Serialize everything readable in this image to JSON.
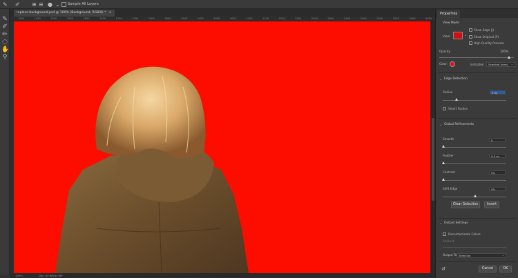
{
  "options_bar": {
    "sample_label": "Sample All Layers"
  },
  "document": {
    "tab_title": "replace background.psd @ 100% (Background, RGB/8) *",
    "close_glyph": "×"
  },
  "ruler_ticks": [
    "1400",
    "1450",
    "1500",
    "1550",
    "1600",
    "1650",
    "1700",
    "1750",
    "1800",
    "1850",
    "1900",
    "1950",
    "2000",
    "2050",
    "2100",
    "2150",
    "2200",
    "2250",
    "2300",
    "2350",
    "2400",
    "2450",
    "2500",
    "2550",
    "2600",
    "2650"
  ],
  "status": {
    "zoom": "100%",
    "doc_info": "Doc: 44.9M/44.9M"
  },
  "colors": {
    "overlay": "#fd0d00"
  },
  "properties": {
    "tab_label": "Properties",
    "view_mode": {
      "title": "View Mode",
      "view_label": "View:",
      "show_edge": "Show Edge (J)",
      "show_original": "Show Original (P)",
      "high_quality": "High Quality Preview"
    },
    "opacity": {
      "label": "Opacity",
      "value": "100%",
      "level": 1.0
    },
    "color": {
      "label": "Color:",
      "indicates_label": "Indicates:",
      "indicates_value": "Selected Areas"
    },
    "edge_detection": {
      "title": "Edge Detection",
      "radius_label": "Radius",
      "radius_value": "0 px",
      "smart_radius": "Smart Radius"
    },
    "global_refinements": {
      "title": "Global Refinements",
      "smooth_label": "Smooth",
      "smooth_value": "0",
      "feather_label": "Feather",
      "feather_value": "0.0 px",
      "contrast_label": "Contrast",
      "contrast_value": "0%",
      "shift_label": "Shift Edge",
      "shift_value": "0%",
      "clear_selection": "Clear Selection",
      "invert": "Invert"
    },
    "output": {
      "title": "Output Settings",
      "decontaminate": "Decontaminate Colors",
      "amount_label": "Amount",
      "output_to_label": "Output To:",
      "output_to_value": "Selection"
    },
    "footer": {
      "cancel": "Cancel",
      "ok": "OK"
    }
  }
}
